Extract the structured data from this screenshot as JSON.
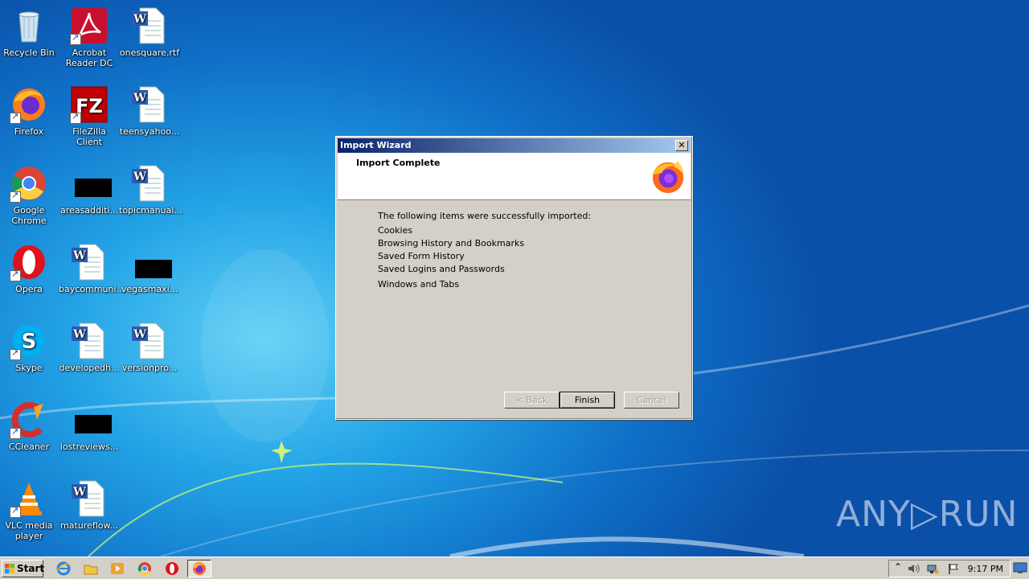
{
  "desktop": {
    "icons": [
      {
        "label": "Recycle Bin"
      },
      {
        "label": "Acrobat Reader DC"
      },
      {
        "label": "onesquare.rtf"
      },
      {
        "label": "Firefox"
      },
      {
        "label": "FileZilla Client"
      },
      {
        "label": "teensyahoo..."
      },
      {
        "label": "Google Chrome"
      },
      {
        "label": "areasadditi..."
      },
      {
        "label": "topicmanual..."
      },
      {
        "label": "Opera"
      },
      {
        "label": "baycommuni..."
      },
      {
        "label": "vegasmaxi..."
      },
      {
        "label": "Skype"
      },
      {
        "label": "developedh..."
      },
      {
        "label": "versionpro..."
      },
      {
        "label": "CCleaner"
      },
      {
        "label": "lostreviews..."
      },
      {
        "label": "VLC media player"
      },
      {
        "label": "matureflow..."
      }
    ]
  },
  "dialog": {
    "title": "Import Wizard",
    "close_label": "✕",
    "header": "Import Complete",
    "intro": "The following items were successfully imported:",
    "items": [
      "Cookies",
      "Browsing History and Bookmarks",
      "Saved Form History",
      "Saved Logins and Passwords",
      "Windows and Tabs"
    ],
    "back_label": "< Back",
    "finish_label": "Finish",
    "cancel_label": "Cancel"
  },
  "watermark": "ANY▷RUN",
  "taskbar": {
    "start_label": "Start",
    "clock": "9:17 PM"
  },
  "colors": {
    "titlebar_start": "#0a246a",
    "titlebar_end": "#a6caf0",
    "dialog_face": "#d4d0c8"
  }
}
